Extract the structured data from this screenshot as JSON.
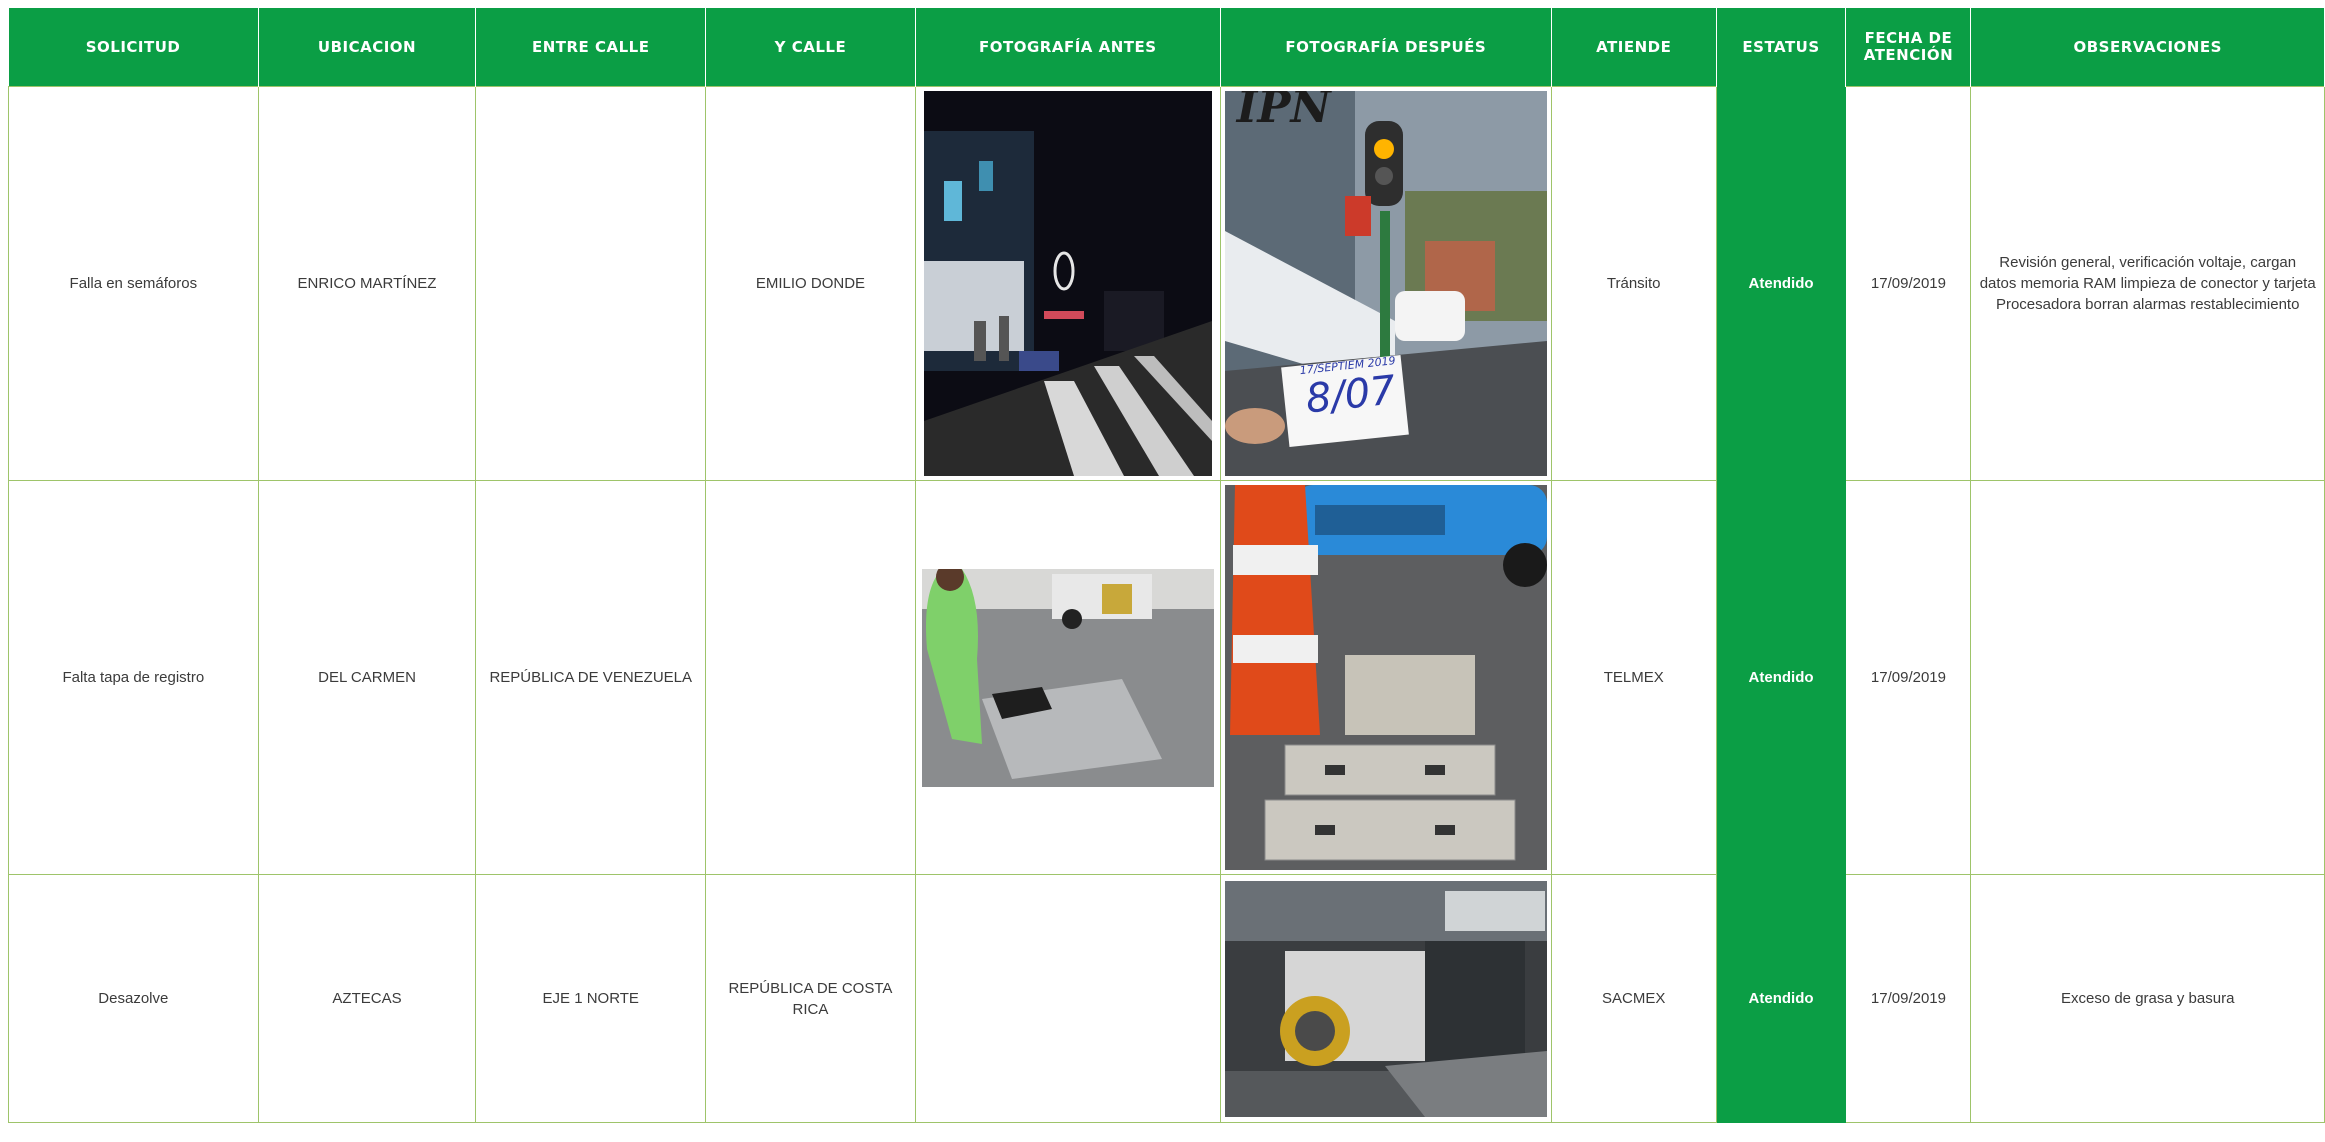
{
  "headers": {
    "solicitud": "SOLICITUD",
    "ubicacion": "UBICACION",
    "entre_calle": "ENTRE CALLE",
    "y_calle": "Y CALLE",
    "foto_antes": "FOTOGRAFÍA ANTES",
    "foto_despues": "FOTOGRAFÍA DESPUÉS",
    "atiende": "ATIENDE",
    "estatus": "ESTATUS",
    "fecha_line1": "FECHA DE",
    "fecha_line2": "ATENCIÓN",
    "observaciones": "OBSERVACIONES"
  },
  "rows": [
    {
      "solicitud": "Falla en semáforos",
      "ubicacion": "ENRICO MARTÍNEZ",
      "entre_calle": "",
      "y_calle": "EMILIO DONDE",
      "atiende": "Tránsito",
      "estatus": "Atendido",
      "fecha": "17/09/2019",
      "observaciones": "Revisión general, verificación voltaje, cargan datos memoria RAM limpieza de conector y tarjeta Procesadora borran alarmas restablecimiento",
      "photo_note_line1": "17/SEPTIEM 2019",
      "photo_note_line2": "8/07",
      "photo_sign": "IPN"
    },
    {
      "solicitud": "Falta tapa de registro",
      "ubicacion": "DEL CARMEN",
      "entre_calle": "REPÚBLICA DE VENEZUELA",
      "y_calle": "",
      "atiende": "TELMEX",
      "estatus": "Atendido",
      "fecha": "17/09/2019",
      "observaciones": ""
    },
    {
      "solicitud": "Desazolve",
      "ubicacion": "AZTECAS",
      "entre_calle": "EJE 1 NORTE",
      "y_calle": "REPÚBLICA DE COSTA RICA",
      "atiende": "SACMEX",
      "estatus": "Atendido",
      "fecha": "17/09/2019",
      "observaciones": "Exceso de grasa y basura"
    }
  ],
  "colors": {
    "header_green": "#0b9e45",
    "border_green": "#9ec46a"
  }
}
